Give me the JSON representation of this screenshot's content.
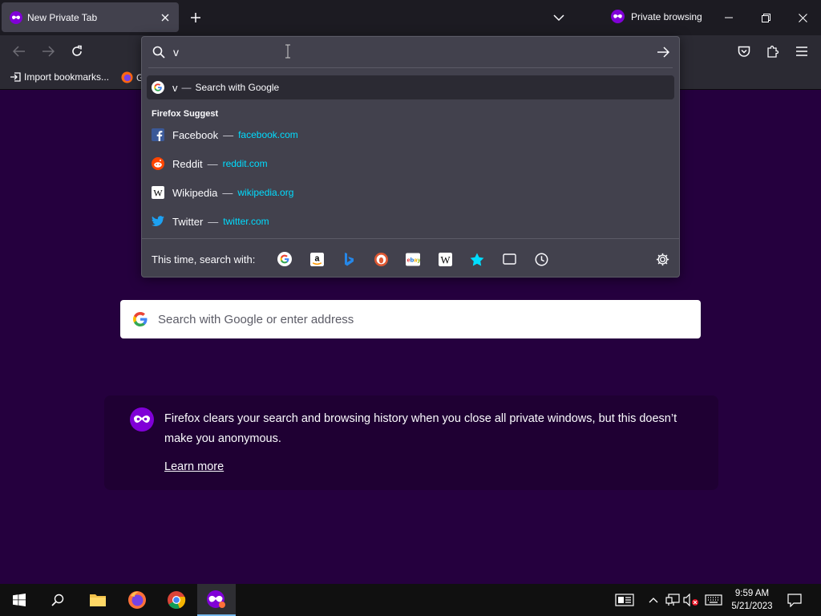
{
  "colors": {
    "accent_private": "#8000d7",
    "link": "#00ddff",
    "content_bg": "#25003e"
  },
  "tab": {
    "title": "New Private Tab"
  },
  "titlebar": {
    "private_label": "Private browsing"
  },
  "bookmarks": {
    "import_label": "Import bookmarks...",
    "second_label": "G"
  },
  "urlbar": {
    "typed_value": "v",
    "google_row": {
      "query": "v",
      "dash": "—",
      "label": "Search with Google"
    },
    "suggest_header": "Firefox Suggest",
    "suggestions": [
      {
        "name": "Facebook",
        "dash": "—",
        "url": "facebook.com",
        "icon": "facebook-icon"
      },
      {
        "name": "Reddit",
        "dash": "—",
        "url": "reddit.com",
        "icon": "reddit-icon"
      },
      {
        "name": "Wikipedia",
        "dash": "—",
        "url": "wikipedia.org",
        "icon": "wikipedia-icon"
      },
      {
        "name": "Twitter",
        "dash": "—",
        "url": "twitter.com",
        "icon": "twitter-icon"
      }
    ],
    "oneoff_label": "This time, search with:",
    "oneoff_engines": [
      "google-icon",
      "amazon-icon",
      "bing-icon",
      "duckduckgo-icon",
      "ebay-icon",
      "wikipedia-icon",
      "bookmarks-star-icon",
      "tabs-icon",
      "history-icon"
    ]
  },
  "content": {
    "search_placeholder": "Search with Google or enter address",
    "info_text": "Firefox clears your search and browsing history when you close all private windows, but this doesn’t make you anonymous.",
    "learn_more": "Learn more"
  },
  "taskbar": {
    "time": "9:59 AM",
    "date": "5/21/2023"
  }
}
